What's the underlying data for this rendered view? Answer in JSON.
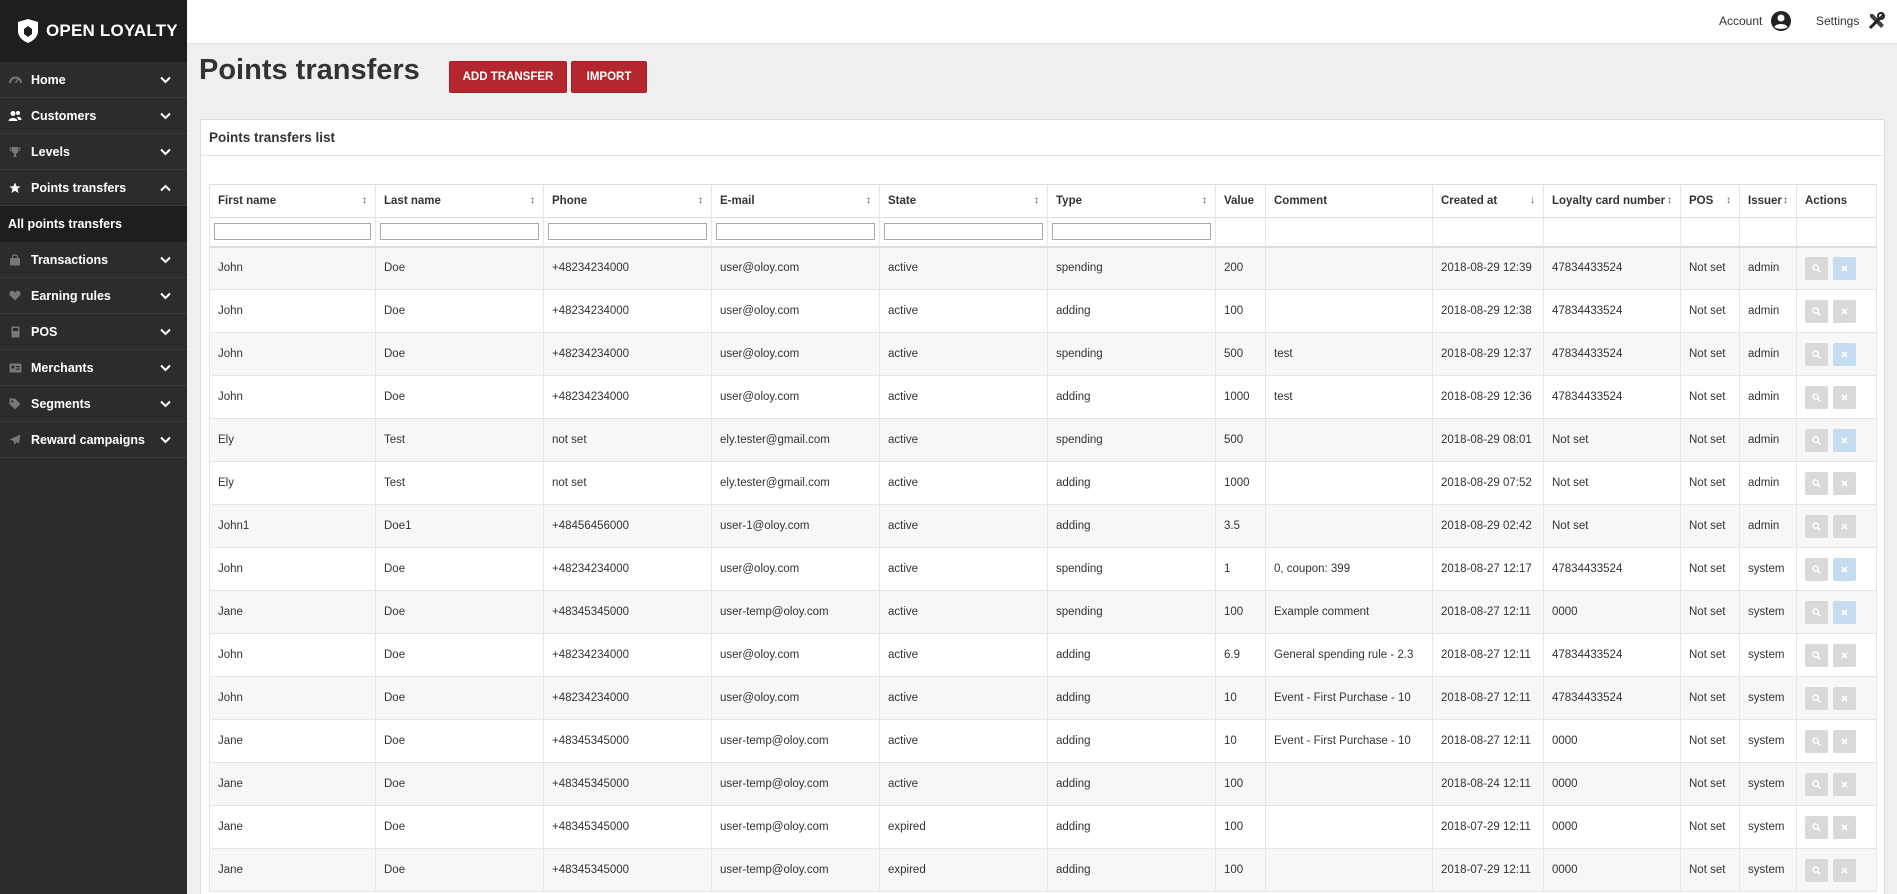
{
  "brand": {
    "name": "OPEN LOYALTY"
  },
  "sidebar": {
    "items": [
      {
        "label": "Home",
        "icon": "dashboard-icon",
        "expanded": false
      },
      {
        "label": "Customers",
        "icon": "users-icon",
        "expanded": false
      },
      {
        "label": "Levels",
        "icon": "trophy-icon",
        "expanded": false
      },
      {
        "label": "Points transfers",
        "icon": "star-icon",
        "expanded": true
      },
      {
        "label": "Transactions",
        "icon": "bag-icon",
        "expanded": false
      },
      {
        "label": "Earning rules",
        "icon": "heart-icon",
        "expanded": false
      },
      {
        "label": "POS",
        "icon": "pos-icon",
        "expanded": false
      },
      {
        "label": "Merchants",
        "icon": "merchant-icon",
        "expanded": false
      },
      {
        "label": "Segments",
        "icon": "tag-icon",
        "expanded": false
      },
      {
        "label": "Reward campaigns",
        "icon": "plane-icon",
        "expanded": false
      }
    ],
    "subitem": "All points transfers"
  },
  "topbar": {
    "account": "Account",
    "settings": "Settings"
  },
  "page": {
    "title": "Points transfers",
    "add_button": "ADD TRANSFER",
    "import_button": "IMPORT",
    "panel_title": "Points transfers list"
  },
  "table": {
    "columns": [
      "First name",
      "Last name",
      "Phone",
      "E-mail",
      "State",
      "Type",
      "Value",
      "Comment",
      "Created at",
      "Loyalty card number",
      "POS",
      "Issuer",
      "Actions"
    ],
    "rows": [
      [
        "John",
        "Doe",
        "+48234234000",
        "user@oloy.com",
        "active",
        "spending",
        "200",
        "",
        "2018-08-29 12:39",
        "47834433524",
        "Not set",
        "admin"
      ],
      [
        "John",
        "Doe",
        "+48234234000",
        "user@oloy.com",
        "active",
        "adding",
        "100",
        "",
        "2018-08-29 12:38",
        "47834433524",
        "Not set",
        "admin"
      ],
      [
        "John",
        "Doe",
        "+48234234000",
        "user@oloy.com",
        "active",
        "spending",
        "500",
        "test",
        "2018-08-29 12:37",
        "47834433524",
        "Not set",
        "admin"
      ],
      [
        "John",
        "Doe",
        "+48234234000",
        "user@oloy.com",
        "active",
        "adding",
        "1000",
        "test",
        "2018-08-29 12:36",
        "47834433524",
        "Not set",
        "admin"
      ],
      [
        "Ely",
        "Test",
        "not set",
        "ely.tester@gmail.com",
        "active",
        "spending",
        "500",
        "",
        "2018-08-29 08:01",
        "Not set",
        "Not set",
        "admin"
      ],
      [
        "Ely",
        "Test",
        "not set",
        "ely.tester@gmail.com",
        "active",
        "adding",
        "1000",
        "",
        "2018-08-29 07:52",
        "Not set",
        "Not set",
        "admin"
      ],
      [
        "John1",
        "Doe1",
        "+48456456000",
        "user-1@oloy.com",
        "active",
        "adding",
        "3.5",
        "",
        "2018-08-29 02:42",
        "Not set",
        "Not set",
        "admin"
      ],
      [
        "John",
        "Doe",
        "+48234234000",
        "user@oloy.com",
        "active",
        "spending",
        "1",
        "0, coupon: 399",
        "2018-08-27 12:17",
        "47834433524",
        "Not set",
        "system"
      ],
      [
        "Jane",
        "Doe",
        "+48345345000",
        "user-temp@oloy.com",
        "active",
        "spending",
        "100",
        "Example comment",
        "2018-08-27 12:11",
        "0000",
        "Not set",
        "system"
      ],
      [
        "John",
        "Doe",
        "+48234234000",
        "user@oloy.com",
        "active",
        "adding",
        "6.9",
        "General spending rule - 2.3",
        "2018-08-27 12:11",
        "47834433524",
        "Not set",
        "system"
      ],
      [
        "John",
        "Doe",
        "+48234234000",
        "user@oloy.com",
        "active",
        "adding",
        "10",
        "Event - First Purchase - 10",
        "2018-08-27 12:11",
        "47834433524",
        "Not set",
        "system"
      ],
      [
        "Jane",
        "Doe",
        "+48345345000",
        "user-temp@oloy.com",
        "active",
        "adding",
        "10",
        "Event - First Purchase - 10",
        "2018-08-27 12:11",
        "0000",
        "Not set",
        "system"
      ],
      [
        "Jane",
        "Doe",
        "+48345345000",
        "user-temp@oloy.com",
        "active",
        "adding",
        "100",
        "",
        "2018-08-24 12:11",
        "0000",
        "Not set",
        "system"
      ],
      [
        "Jane",
        "Doe",
        "+48345345000",
        "user-temp@oloy.com",
        "expired",
        "adding",
        "100",
        "",
        "2018-07-29 12:11",
        "0000",
        "Not set",
        "system"
      ],
      [
        "Jane",
        "Doe",
        "+48345345000",
        "user-temp@oloy.com",
        "expired",
        "adding",
        "100",
        "",
        "2018-07-29 12:11",
        "0000",
        "Not set",
        "system"
      ]
    ]
  },
  "colors": {
    "accent": "#b5272e",
    "sidebar": "#2c2c2c",
    "cancel_active": "#c5dbef"
  }
}
